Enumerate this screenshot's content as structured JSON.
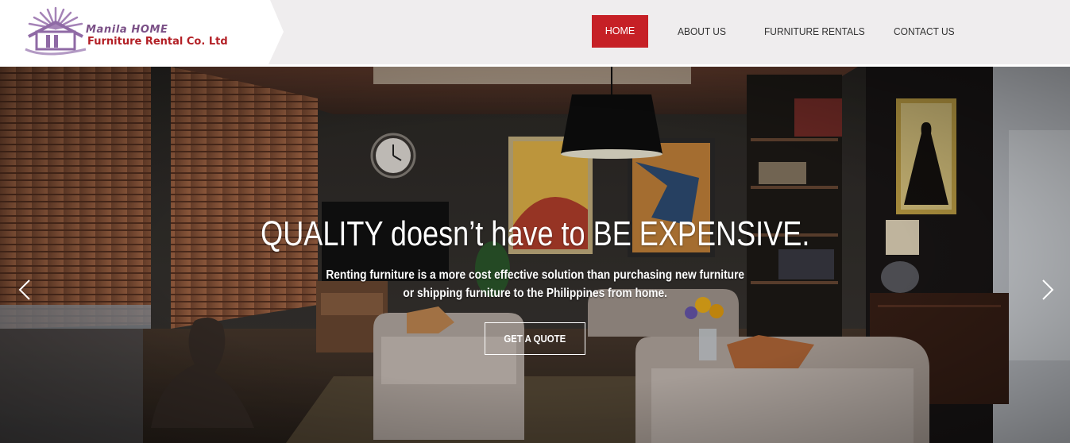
{
  "logo": {
    "line1": "Manila HOME",
    "line2": "Furniture Rental Co. Ltd",
    "mark_icon": "house-sunburst-logo-icon",
    "colors": {
      "line1": "#7a4f86",
      "line2": "#b32026"
    }
  },
  "nav": {
    "items": [
      {
        "label": "HOME",
        "active": true
      },
      {
        "label": "ABOUT US",
        "active": false
      },
      {
        "label": "FURNITURE RENTALS",
        "active": false
      },
      {
        "label": "CONTACT US",
        "active": false
      }
    ],
    "active_color": "#c62026"
  },
  "hero": {
    "title": "QUALITY doesn’t have to BE EXPENSIVE.",
    "subtitle_line1": "Renting furniture is a more cost effective solution than purchasing new furniture",
    "subtitle_line2": "or shipping furniture to the Philippines from home.",
    "cta_label": "GET A QUOTE",
    "prev_icon": "chevron-left-icon",
    "next_icon": "chevron-right-icon"
  }
}
